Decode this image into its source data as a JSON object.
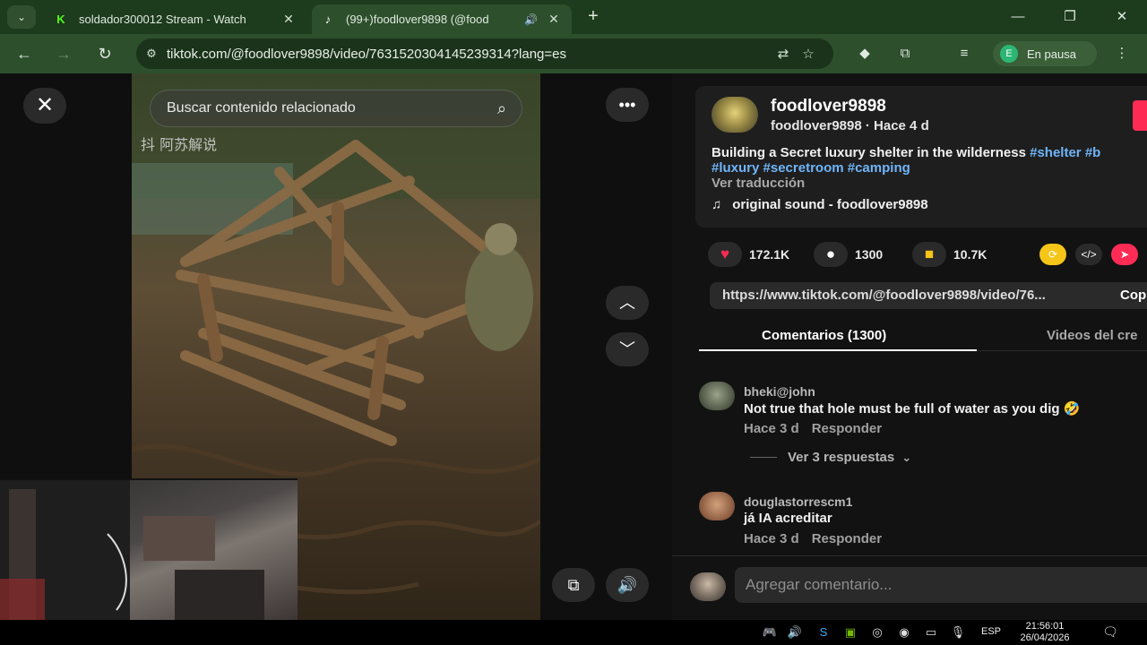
{
  "browser": {
    "tabs": [
      {
        "title": "soldador300012 Stream - Watch",
        "favicon": "kick-icon",
        "active": false
      },
      {
        "title": "(99+)foodlover9898 (@food",
        "favicon": "tiktok-icon",
        "active": true
      }
    ],
    "url": "tiktok.com/@foodlover9898/video/7631520304145239314?lang=es",
    "profile": {
      "initial": "E",
      "label": "En pausa"
    }
  },
  "video": {
    "search_placeholder": "Buscar contenido relacionado",
    "watermark": "抖 阿苏解说"
  },
  "post": {
    "author": "foodlover9898",
    "author_sub": "foodlover9898 · Hace 4 d",
    "description": "Building a Secret luxury shelter in the wilderness ",
    "hashtags": {
      "shelter": "#shelter",
      "b": "#b",
      "luxury": "#luxury",
      "secretroom": "#secretroom",
      "camping": "#camping"
    },
    "translate": "Ver traducción",
    "sound": "original sound - foodlover9898",
    "likes": "172.1K",
    "comments": "1300",
    "saves": "10.7K",
    "link": "https://www.tiktok.com/@foodlover9898/video/76...",
    "copy_label": "Cop"
  },
  "comment_tabs": {
    "comments": "Comentarios (1300)",
    "creator_videos": "Videos del cre"
  },
  "comments": [
    {
      "user": "bheki@john",
      "text": "Not true that hole must be full of water as you dig 🤣",
      "time": "Hace 3 d",
      "reply": "Responder",
      "view_replies": "Ver 3 respuestas"
    },
    {
      "user": "douglastorrescm1",
      "text": "já IA acreditar",
      "time": "Hace 3 d",
      "reply": "Responder"
    }
  ],
  "composer": {
    "placeholder": "Agregar comentario..."
  },
  "taskbar": {
    "lang": "ESP",
    "time": "21:56:01",
    "date": "26/04/2026"
  },
  "colors": {
    "accent": "#fe2c55",
    "hashtag": "#70b5f9",
    "chrome": "#2d4f2c"
  }
}
